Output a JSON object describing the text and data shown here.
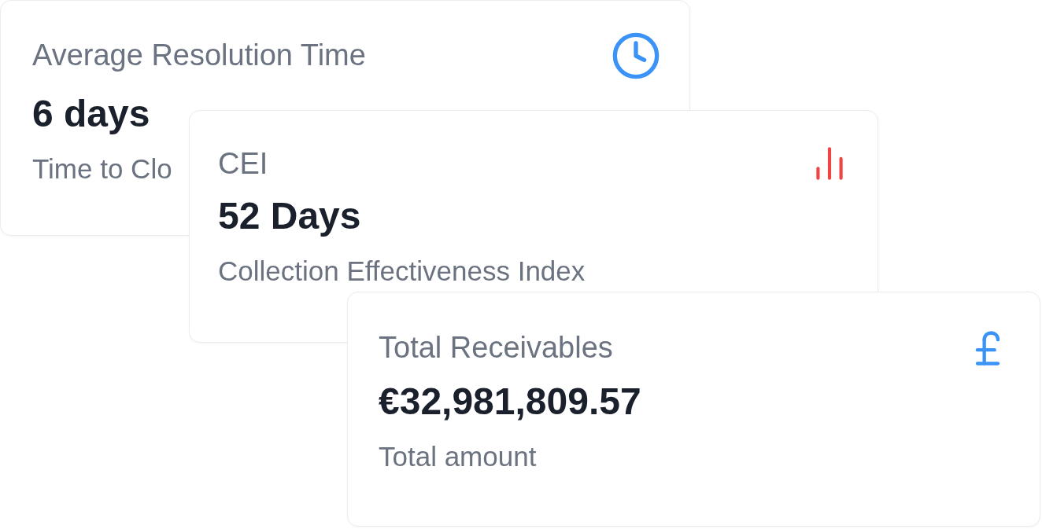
{
  "cards": [
    {
      "kind": "clock",
      "color": "#3b93f7",
      "title": "Average Resolution Time",
      "value": "6 days",
      "subtitle": "Time to Clo"
    },
    {
      "kind": "bars",
      "color": "#ef4444",
      "title": "CEI",
      "value": "52 Days",
      "subtitle": "Collection Effectiveness Index"
    },
    {
      "kind": "pound",
      "color": "#3b93f7",
      "title": "Total Receivables",
      "value": "€32,981,809.57",
      "subtitle": "Total amount"
    }
  ]
}
